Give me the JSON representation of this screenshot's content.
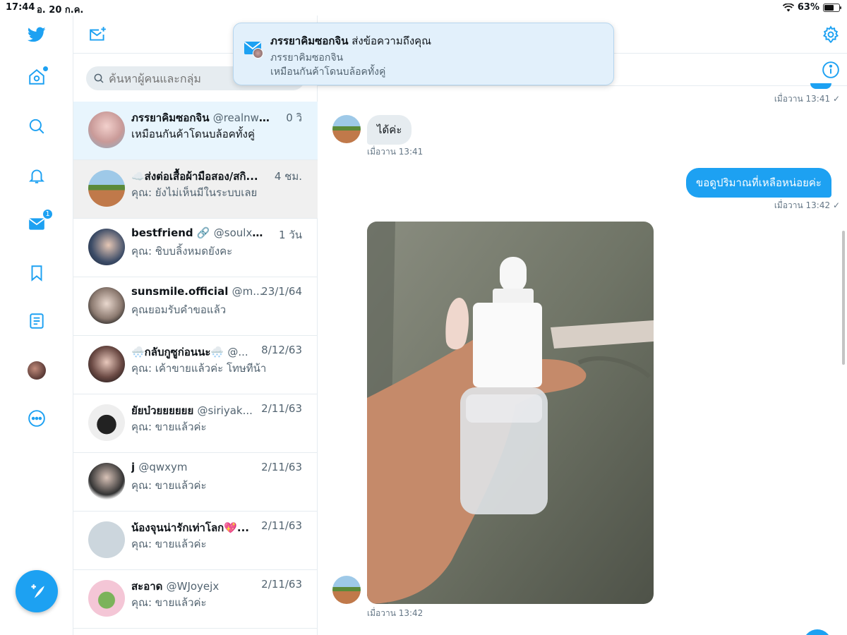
{
  "status": {
    "time": "17:44",
    "date": "อ. 20 ก.ค.",
    "battery": "63%",
    "battery_level": 0.63
  },
  "nav": {
    "messages_badge": "1"
  },
  "search": {
    "placeholder": "ค้นหาผู้คนและกลุ่ม"
  },
  "conversations": [
    {
      "name": "ภรรยาคิมซอกจิน",
      "handle": "@realnwaa...",
      "time": "0 วิ",
      "preview": "เหมือนกันค้าโดนบล้อคทั้งคู่"
    },
    {
      "name": "☁️ส่งต่อเสื้อผ้ามือสอง/สกิ...",
      "handle": "",
      "time": "4 ชม.",
      "preview": "คุณ: ยังไม่เห็นมีในระบบเลย"
    },
    {
      "name": "bestfriend 🔗",
      "handle": "@soulxmnp",
      "time": "1 วัน",
      "preview": "คุณ: ชิบบลิ้งหมดยังคะ"
    },
    {
      "name": "sunsmile.official",
      "handle": "@m...",
      "time": "23/1/64",
      "preview": "คุณยอมรับคำขอแล้ว"
    },
    {
      "name": "🌨️กลับกูซูก่อนนะ🌨️",
      "handle": "@...",
      "time": "8/12/63",
      "preview": "คุณ: เค้าขายแล้วค่ะ โทษทีน้า"
    },
    {
      "name": "ยัยบ๋วยยยยยย",
      "handle": "@siriyak...",
      "time": "2/11/63",
      "preview": "คุณ: ขายแล้วค่ะ"
    },
    {
      "name": "j",
      "handle": "@qwxym",
      "time": "2/11/63",
      "preview": "คุณ: ขายแล้วค่ะ"
    },
    {
      "name": "น้องจุนน่ารักเท่าโลก💖...",
      "handle": "",
      "time": "2/11/63",
      "preview": "คุณ: ขายแล้วค่ะ"
    },
    {
      "name": "สะอาด",
      "handle": "@WJoyejx",
      "time": "2/11/63",
      "preview": "คุณ: ขายแล้วค่ะ"
    }
  ],
  "chat": {
    "top_meta": "เมื่อวาน 13:41 ✓",
    "msg1": {
      "text": "ได้ค่ะ",
      "time": "เมื่อวาน 13:41"
    },
    "msg2": {
      "text": "ขอดูปริมาณที่เหลือหน่อยค่ะ",
      "time": "เมื่อวาน 13:42 ✓"
    },
    "photo_time": "เมื่อวาน 13:42"
  },
  "notification": {
    "sender": "ภรรยาคิมซอกจิน",
    "action": "ส่งข้อความถึงคุณ",
    "line1": "ภรรยาคิมซอกจิน",
    "line2": "เหมือนกันค้าโดนบล้อคทั้งคู่"
  },
  "colors": {
    "accent": "#1da1f2",
    "selected_row": "#e8f5fd",
    "bubble_in": "#e6ecf0"
  }
}
